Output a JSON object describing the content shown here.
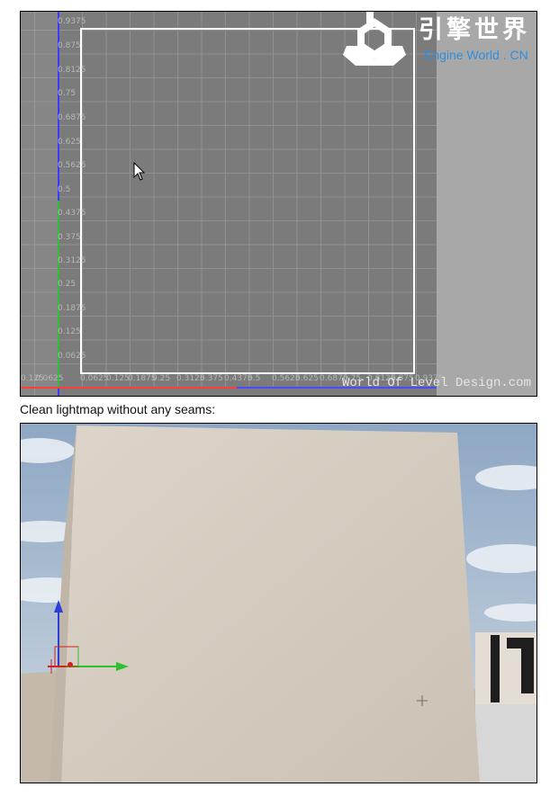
{
  "uv_editor": {
    "v_ticks": [
      "0.9375",
      "0.875",
      "0.8125",
      "0.75",
      "0.6875",
      "0.625",
      "0.5625",
      "0.5",
      "0.4375",
      "0.375",
      "0.3125",
      "0.25",
      "0.1875",
      "0.125",
      "0.0625"
    ],
    "h_ticks": [
      "0.125",
      "0.0625",
      "0.0625",
      "0.125",
      "0.1875",
      "0.25",
      "0.3125",
      "0.375",
      "0.4375",
      "0.5",
      "0.5625",
      "0.625",
      "0.6875",
      "0.75",
      "0.8125",
      "0.875",
      "0.9375"
    ],
    "logo_cn": "引擎世界",
    "logo_en": "Engine World . CN",
    "watermark": "World Of Level Design.com",
    "colors": {
      "grid_bg": "#7b7b7b",
      "grid_line": "#a4a4a4",
      "uv_shell": "#ffffff",
      "u_axis": "#ff3b3b",
      "v_axis": "#3b3bff",
      "gutter": "#a8a8a8"
    }
  },
  "caption": "Clean lightmap without any seams:",
  "viewport": {
    "colors": {
      "wall": "#d8cfc2",
      "floor": "#c4b9ab",
      "sky": "#aebfd0"
    }
  }
}
